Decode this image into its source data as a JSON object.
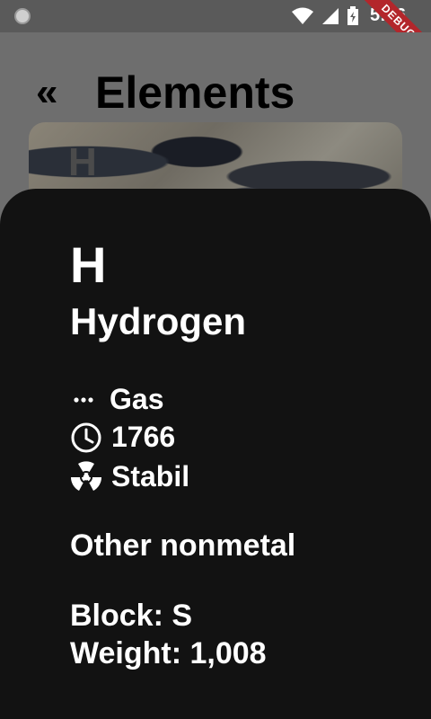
{
  "status_bar": {
    "time": "5:06",
    "debug_label": "DEBUG"
  },
  "app_bar": {
    "title": "Elements",
    "back_icon": "double-chevron-left-icon"
  },
  "list": {
    "first_card_symbol": "H"
  },
  "sheet": {
    "symbol": "H",
    "name": "Hydrogen",
    "state": "Gas",
    "year": "1766",
    "stability": "Stabil",
    "category": "Other nonmetal",
    "block": "Block: S",
    "weight": "Weight: 1,008",
    "icons": [
      "dots-horizontal-icon",
      "clock-icon",
      "radiation-icon"
    ]
  }
}
